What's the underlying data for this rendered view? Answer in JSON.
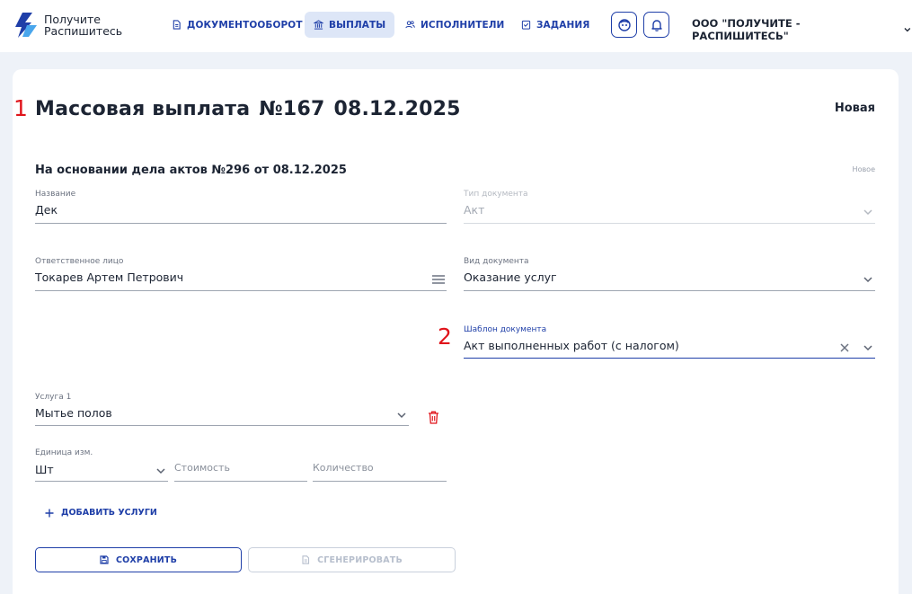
{
  "header": {
    "logo_line1": "Получите",
    "logo_line2": "Распишитесь",
    "nav": [
      {
        "label": "ДОКУМЕНТООБОРОТ",
        "icon": "document-icon",
        "active": false
      },
      {
        "label": "ВЫПЛАТЫ",
        "icon": "bank-icon",
        "active": true
      },
      {
        "label": "ИСПОЛНИТЕЛИ",
        "icon": "users-icon",
        "active": false
      },
      {
        "label": "ЗАДАНИЯ",
        "icon": "checklist-icon",
        "active": false
      }
    ],
    "org_name": "ООО \"ПОЛУЧИТЕ - РАСПИШИТЕСЬ\""
  },
  "markers": {
    "first": "1",
    "second": "2"
  },
  "page": {
    "title_prefix": "Массовая выплата",
    "title_number": "№167",
    "title_date": "08.12.2025",
    "status": "Новая",
    "basis": "На основании дела актов №296 от 08.12.2025",
    "basis_status": "Новое"
  },
  "form": {
    "name": {
      "label": "Название",
      "value": "Дек"
    },
    "doc_type": {
      "label": "Тип документа",
      "value": "Акт"
    },
    "responsible": {
      "label": "Ответственное лицо",
      "value": "Токарев Артем Петрович"
    },
    "doc_kind": {
      "label": "Вид документа",
      "value": "Оказание услуг"
    },
    "template": {
      "label": "Шаблон документа",
      "value": "Акт выполненных работ (с налогом)"
    },
    "service": {
      "label": "Услуга 1",
      "value": "Мытье полов"
    },
    "unit": {
      "label": "Единица изм.",
      "value": "Шт"
    },
    "cost": {
      "placeholder": "Стоимость"
    },
    "quantity": {
      "placeholder": "Количество"
    },
    "add_service": "ДОБАВИТЬ УСЛУГИ"
  },
  "actions": {
    "save": "СОХРАНИТЬ",
    "generate": "СГЕНЕРИРОВАТЬ"
  },
  "colors": {
    "accent": "#1f3fa8",
    "danger": "#e0141b",
    "background": "#eef2f8"
  }
}
